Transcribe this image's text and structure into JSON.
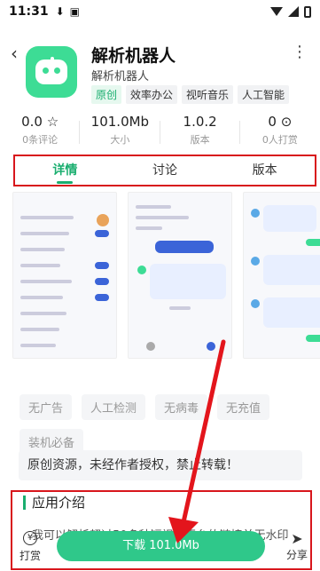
{
  "status": {
    "time": "11:31"
  },
  "app": {
    "title": "解析机器人",
    "subtitle": "解析机器人",
    "tags": [
      "原创",
      "效率办公",
      "视听音乐",
      "人工智能"
    ]
  },
  "stats": [
    {
      "value": "0.0 ☆",
      "label": "0条评论"
    },
    {
      "value": "101.0Mb",
      "label": "大小"
    },
    {
      "value": "1.0.2",
      "label": "版本"
    },
    {
      "value": "0 ⊙",
      "label": "0人打赏"
    }
  ],
  "tabs": [
    {
      "label": "详情"
    },
    {
      "label": "讨论"
    },
    {
      "label": "版本"
    }
  ],
  "chips": [
    "无广告",
    "人工检测",
    "无病毒",
    "无充值",
    "装机必备"
  ],
  "notice": "原创资源，未经作者授权，禁止转载！",
  "intro": {
    "title": "应用介绍",
    "text": "我可以解析超过50多种短视频平台的链接并无水印"
  },
  "bottom": {
    "tip_label": "打赏",
    "download_label": "下载 101.0Mb",
    "share_label": "分享"
  },
  "colors": {
    "accent": "#1aae6f",
    "annotation": "#d8161c",
    "download": "#2fc88a"
  }
}
